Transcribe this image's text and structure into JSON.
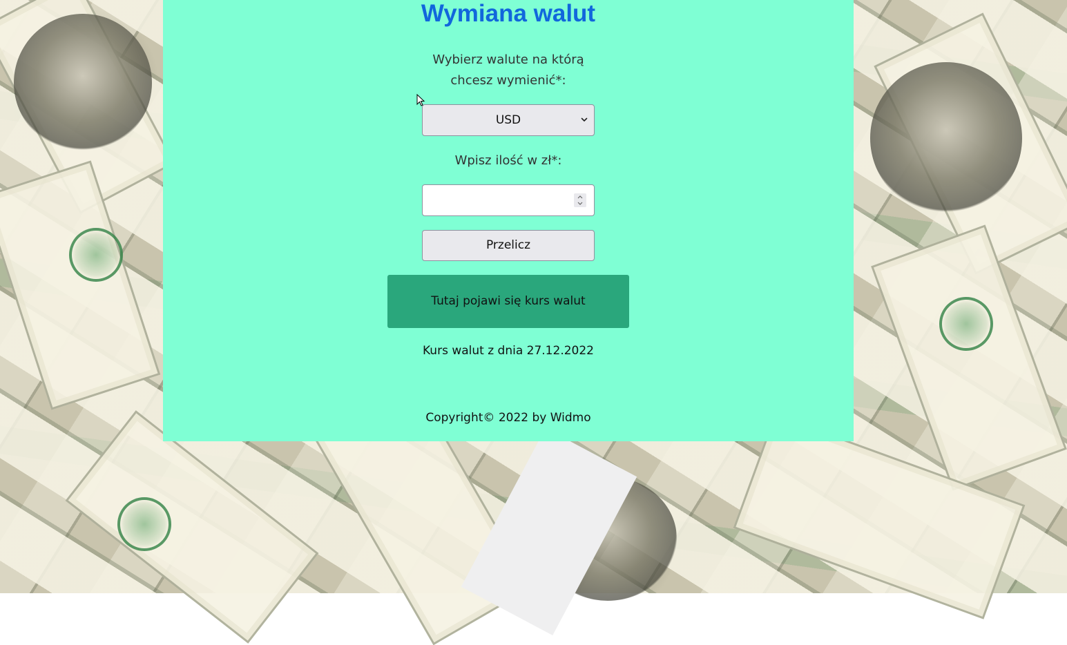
{
  "page": {
    "title": "Wymiana walut",
    "currency_label_line1": "Wybierz walute na którą",
    "currency_label_line2": "chcesz wymienić*:",
    "currency_select": {
      "selected": "USD"
    },
    "amount_label": "Wpisz ilość w zł*:",
    "amount_input": {
      "value": ""
    },
    "calculate_button": "Przelicz",
    "result_text": "Tutaj pojawi się kurs walut",
    "rate_date_text": "Kurs walut z dnia 27.12.2022",
    "footer_text": "Copyright© 2022 by Widmo"
  },
  "colors": {
    "panel_background": "#7fffd4",
    "title": "#1167dc",
    "result_box": "#2aa77c"
  },
  "icons": {
    "select_arrow": "chevron-down-icon",
    "spinner": "spinner-arrows-icon",
    "cursor": "mouse-pointer-icon"
  }
}
